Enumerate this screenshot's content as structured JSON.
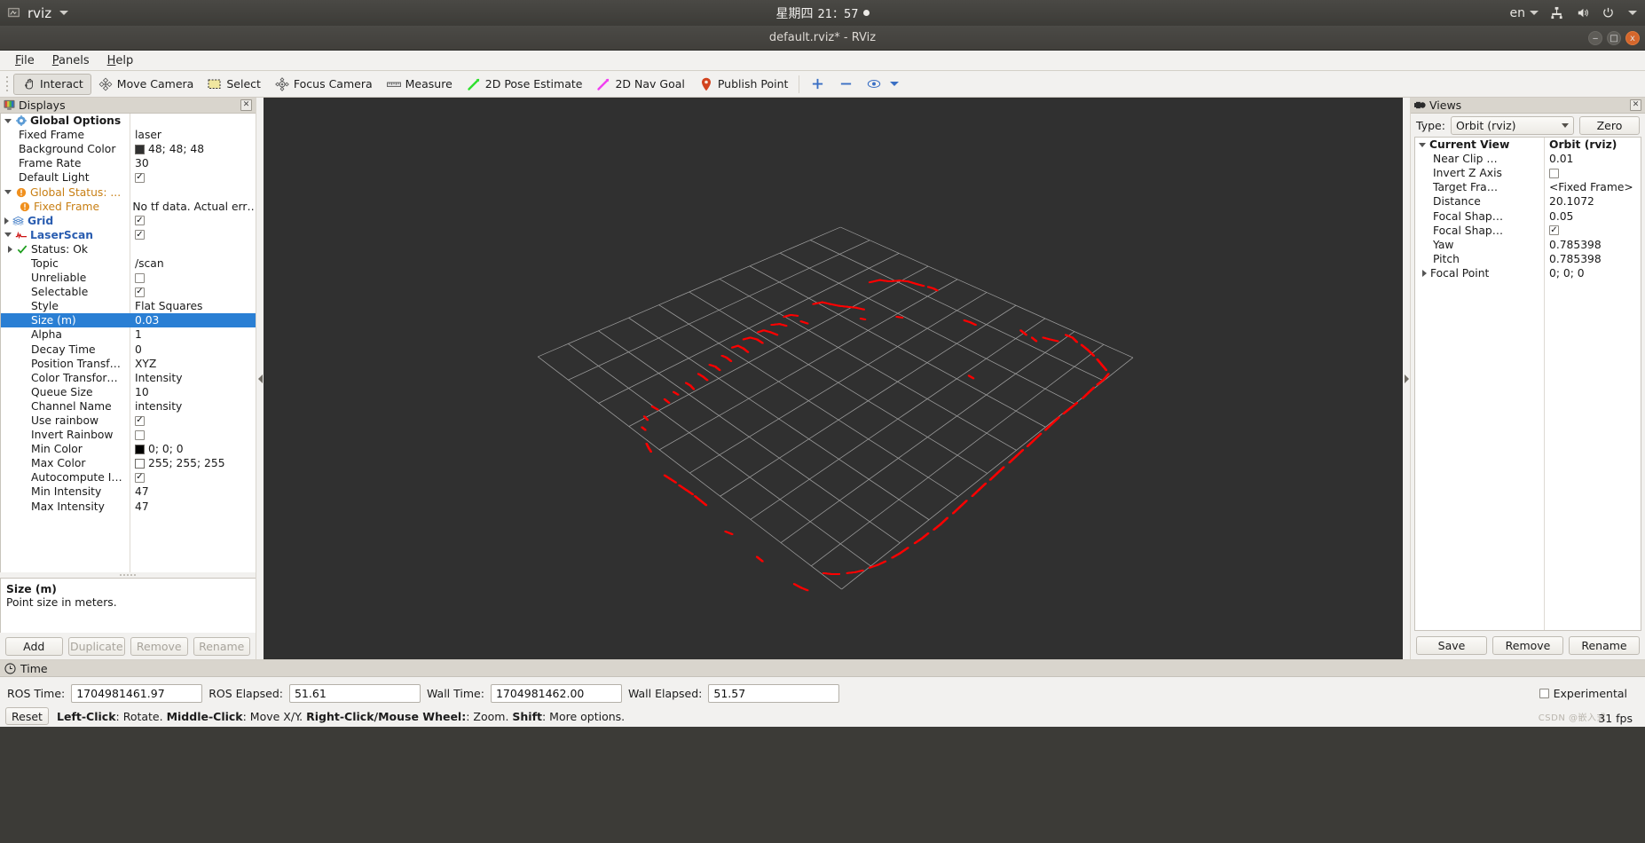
{
  "system_bar": {
    "app_name": "rviz",
    "app_icon": "rviz-icon",
    "date": "星期四",
    "time": "21：57",
    "language": "en",
    "icons": [
      "network-icon",
      "volume-icon",
      "power-icon"
    ]
  },
  "window": {
    "title": "default.rviz* - RViz",
    "minimize_label": "‒",
    "maximize_label": "□",
    "close_label": "x"
  },
  "menubar": {
    "items": [
      {
        "label": "File",
        "mnemonic": "F",
        "rest": "ile"
      },
      {
        "label": "Panels",
        "mnemonic": "P",
        "rest": "anels"
      },
      {
        "label": "Help",
        "mnemonic": "H",
        "rest": "elp"
      }
    ]
  },
  "toolbar": {
    "buttons": [
      {
        "label": "Interact",
        "icon": "hand-cursor-icon",
        "active": true
      },
      {
        "label": "Move Camera",
        "icon": "move-camera-icon",
        "active": false
      },
      {
        "label": "Select",
        "icon": "select-rect-icon",
        "active": false
      },
      {
        "label": "Focus Camera",
        "icon": "focus-camera-icon",
        "active": false
      },
      {
        "label": "Measure",
        "icon": "measure-ruler-icon",
        "active": false
      },
      {
        "label": "2D Pose Estimate",
        "icon": "pose-estimate-arrow-icon",
        "active": false
      },
      {
        "label": "2D Nav Goal",
        "icon": "nav-goal-arrow-icon",
        "active": false
      },
      {
        "label": "Publish Point",
        "icon": "publish-point-pin-icon",
        "active": false
      }
    ],
    "extra_icons": [
      "add-tool-icon",
      "remove-tool-icon",
      "tool-properties-icon"
    ]
  },
  "displays_panel": {
    "title": "Displays",
    "icon": "displays-monitor-icon",
    "close_label": "✕",
    "tree": [
      {
        "indent": 0,
        "arrow": "down",
        "icon": "gear-icon",
        "name": "Global Options",
        "value": "",
        "value_type": "none",
        "style": "bold"
      },
      {
        "indent": 1,
        "arrow": "none",
        "icon": "none",
        "name": "Fixed Frame",
        "value": "laser",
        "value_type": "text"
      },
      {
        "indent": 1,
        "arrow": "none",
        "icon": "none",
        "name": "Background Color",
        "value": "48; 48; 48",
        "value_type": "color",
        "color": "#303030"
      },
      {
        "indent": 1,
        "arrow": "none",
        "icon": "none",
        "name": "Frame Rate",
        "value": "30",
        "value_type": "text"
      },
      {
        "indent": 1,
        "arrow": "none",
        "icon": "none",
        "name": "Default Light",
        "value": "",
        "value_type": "checkbox",
        "checked": true
      },
      {
        "indent": 0,
        "arrow": "down",
        "icon": "warning-icon",
        "name": "Global Status: ...",
        "value": "",
        "value_type": "none",
        "style": "warn"
      },
      {
        "indent": 1,
        "arrow": "none",
        "icon": "warning-icon",
        "name": "Fixed Frame",
        "value": "No tf data.  Actual err…",
        "value_type": "text",
        "style": "warn"
      },
      {
        "indent": 0,
        "arrow": "right",
        "icon": "grid-icon",
        "name": "Grid",
        "value": "",
        "value_type": "checkbox",
        "checked": true,
        "style": "link"
      },
      {
        "indent": 0,
        "arrow": "down",
        "icon": "laserscan-icon",
        "name": "LaserScan",
        "value": "",
        "value_type": "checkbox",
        "checked": true,
        "style": "link"
      },
      {
        "indent": 1,
        "arrow": "right",
        "icon": "check-ok-icon",
        "name": "Status: Ok",
        "value": "",
        "value_type": "none"
      },
      {
        "indent": 2,
        "arrow": "none",
        "icon": "none",
        "name": "Topic",
        "value": "/scan",
        "value_type": "text"
      },
      {
        "indent": 2,
        "arrow": "none",
        "icon": "none",
        "name": "Unreliable",
        "value": "",
        "value_type": "checkbox",
        "checked": false
      },
      {
        "indent": 2,
        "arrow": "none",
        "icon": "none",
        "name": "Selectable",
        "value": "",
        "value_type": "checkbox",
        "checked": true
      },
      {
        "indent": 2,
        "arrow": "none",
        "icon": "none",
        "name": "Style",
        "value": "Flat Squares",
        "value_type": "text"
      },
      {
        "indent": 2,
        "arrow": "none",
        "icon": "none",
        "name": "Size (m)",
        "value": "0.03",
        "value_type": "text",
        "selected": true
      },
      {
        "indent": 2,
        "arrow": "none",
        "icon": "none",
        "name": "Alpha",
        "value": "1",
        "value_type": "text"
      },
      {
        "indent": 2,
        "arrow": "none",
        "icon": "none",
        "name": "Decay Time",
        "value": "0",
        "value_type": "text"
      },
      {
        "indent": 2,
        "arrow": "none",
        "icon": "none",
        "name": "Position Transf…",
        "value": "XYZ",
        "value_type": "text"
      },
      {
        "indent": 2,
        "arrow": "none",
        "icon": "none",
        "name": "Color Transfor…",
        "value": "Intensity",
        "value_type": "text"
      },
      {
        "indent": 2,
        "arrow": "none",
        "icon": "none",
        "name": "Queue Size",
        "value": "10",
        "value_type": "text"
      },
      {
        "indent": 2,
        "arrow": "none",
        "icon": "none",
        "name": "Channel Name",
        "value": "intensity",
        "value_type": "text"
      },
      {
        "indent": 2,
        "arrow": "none",
        "icon": "none",
        "name": "Use rainbow",
        "value": "",
        "value_type": "checkbox",
        "checked": true
      },
      {
        "indent": 2,
        "arrow": "none",
        "icon": "none",
        "name": "Invert Rainbow",
        "value": "",
        "value_type": "checkbox",
        "checked": false
      },
      {
        "indent": 2,
        "arrow": "none",
        "icon": "none",
        "name": "Min Color",
        "value": "0; 0; 0",
        "value_type": "color",
        "color": "#000000"
      },
      {
        "indent": 2,
        "arrow": "none",
        "icon": "none",
        "name": "Max Color",
        "value": "255; 255; 255",
        "value_type": "color",
        "color": "#ffffff"
      },
      {
        "indent": 2,
        "arrow": "none",
        "icon": "none",
        "name": "Autocompute I…",
        "value": "",
        "value_type": "checkbox",
        "checked": true
      },
      {
        "indent": 2,
        "arrow": "none",
        "icon": "none",
        "name": "Min Intensity",
        "value": "47",
        "value_type": "text"
      },
      {
        "indent": 2,
        "arrow": "none",
        "icon": "none",
        "name": "Max Intensity",
        "value": "47",
        "value_type": "text"
      }
    ],
    "description": {
      "title": "Size (m)",
      "body": "Point size in meters."
    },
    "buttons": [
      {
        "label": "Add",
        "enabled": true
      },
      {
        "label": "Duplicate",
        "enabled": false
      },
      {
        "label": "Remove",
        "enabled": false
      },
      {
        "label": "Rename",
        "enabled": false
      }
    ]
  },
  "views_panel": {
    "title": "Views",
    "icon": "views-camera-icon",
    "close_label": "✕",
    "type_label": "Type:",
    "type_value": "Orbit (rviz)",
    "zero_label": "Zero",
    "tree": [
      {
        "indent": 0,
        "arrow": "down",
        "name": "Current View",
        "value": "Orbit (rviz)",
        "value_type": "text",
        "style": "bold"
      },
      {
        "indent": 1,
        "arrow": "none",
        "name": "Near Clip …",
        "value": "0.01",
        "value_type": "text"
      },
      {
        "indent": 1,
        "arrow": "none",
        "name": "Invert Z Axis",
        "value": "",
        "value_type": "checkbox",
        "checked": false
      },
      {
        "indent": 1,
        "arrow": "none",
        "name": "Target Fra…",
        "value": "<Fixed Frame>",
        "value_type": "text"
      },
      {
        "indent": 1,
        "arrow": "none",
        "name": "Distance",
        "value": "20.1072",
        "value_type": "text"
      },
      {
        "indent": 1,
        "arrow": "none",
        "name": "Focal Shap…",
        "value": "0.05",
        "value_type": "text"
      },
      {
        "indent": 1,
        "arrow": "none",
        "name": "Focal Shap…",
        "value": "",
        "value_type": "checkbox",
        "checked": true
      },
      {
        "indent": 1,
        "arrow": "none",
        "name": "Yaw",
        "value": "0.785398",
        "value_type": "text"
      },
      {
        "indent": 1,
        "arrow": "none",
        "name": "Pitch",
        "value": "0.785398",
        "value_type": "text"
      },
      {
        "indent": 1,
        "arrow": "right",
        "name": "Focal Point",
        "value": "0; 0; 0",
        "value_type": "text"
      }
    ],
    "buttons": [
      {
        "label": "Save",
        "enabled": true
      },
      {
        "label": "Remove",
        "enabled": true
      },
      {
        "label": "Rename",
        "enabled": true
      }
    ]
  },
  "viewport": {
    "background_color": "#303030",
    "grid_color": "#b4b4b4",
    "scan_color": "#ff0000",
    "grid_cells": 10
  },
  "time_panel": {
    "title": "Time",
    "icon": "clock-icon",
    "fields": [
      {
        "label": "ROS Time:",
        "value": "1704981461.97",
        "key": "ros-time"
      },
      {
        "label": "ROS Elapsed:",
        "value": "51.61",
        "key": "ros-elapsed"
      },
      {
        "label": "Wall Time:",
        "value": "1704981462.00",
        "key": "wall-time"
      },
      {
        "label": "Wall Elapsed:",
        "value": "51.57",
        "key": "wall-elapsed"
      }
    ],
    "experimental_label": "Experimental",
    "experimental_checked": false
  },
  "status_bar": {
    "reset_label": "Reset",
    "hint_parts": [
      {
        "text": "Left-Click",
        "bold": true
      },
      {
        "text": ": Rotate.  ",
        "bold": false
      },
      {
        "text": "Middle-Click",
        "bold": true
      },
      {
        "text": ": Move X/Y.  ",
        "bold": false
      },
      {
        "text": "Right-Click/Mouse Wheel:",
        "bold": true
      },
      {
        "text": ": Zoom.  ",
        "bold": false
      },
      {
        "text": "Shift",
        "bold": true
      },
      {
        "text": ": More options.",
        "bold": false
      }
    ],
    "fps": "31 fps",
    "watermark": "CSDN @嵌入式"
  }
}
